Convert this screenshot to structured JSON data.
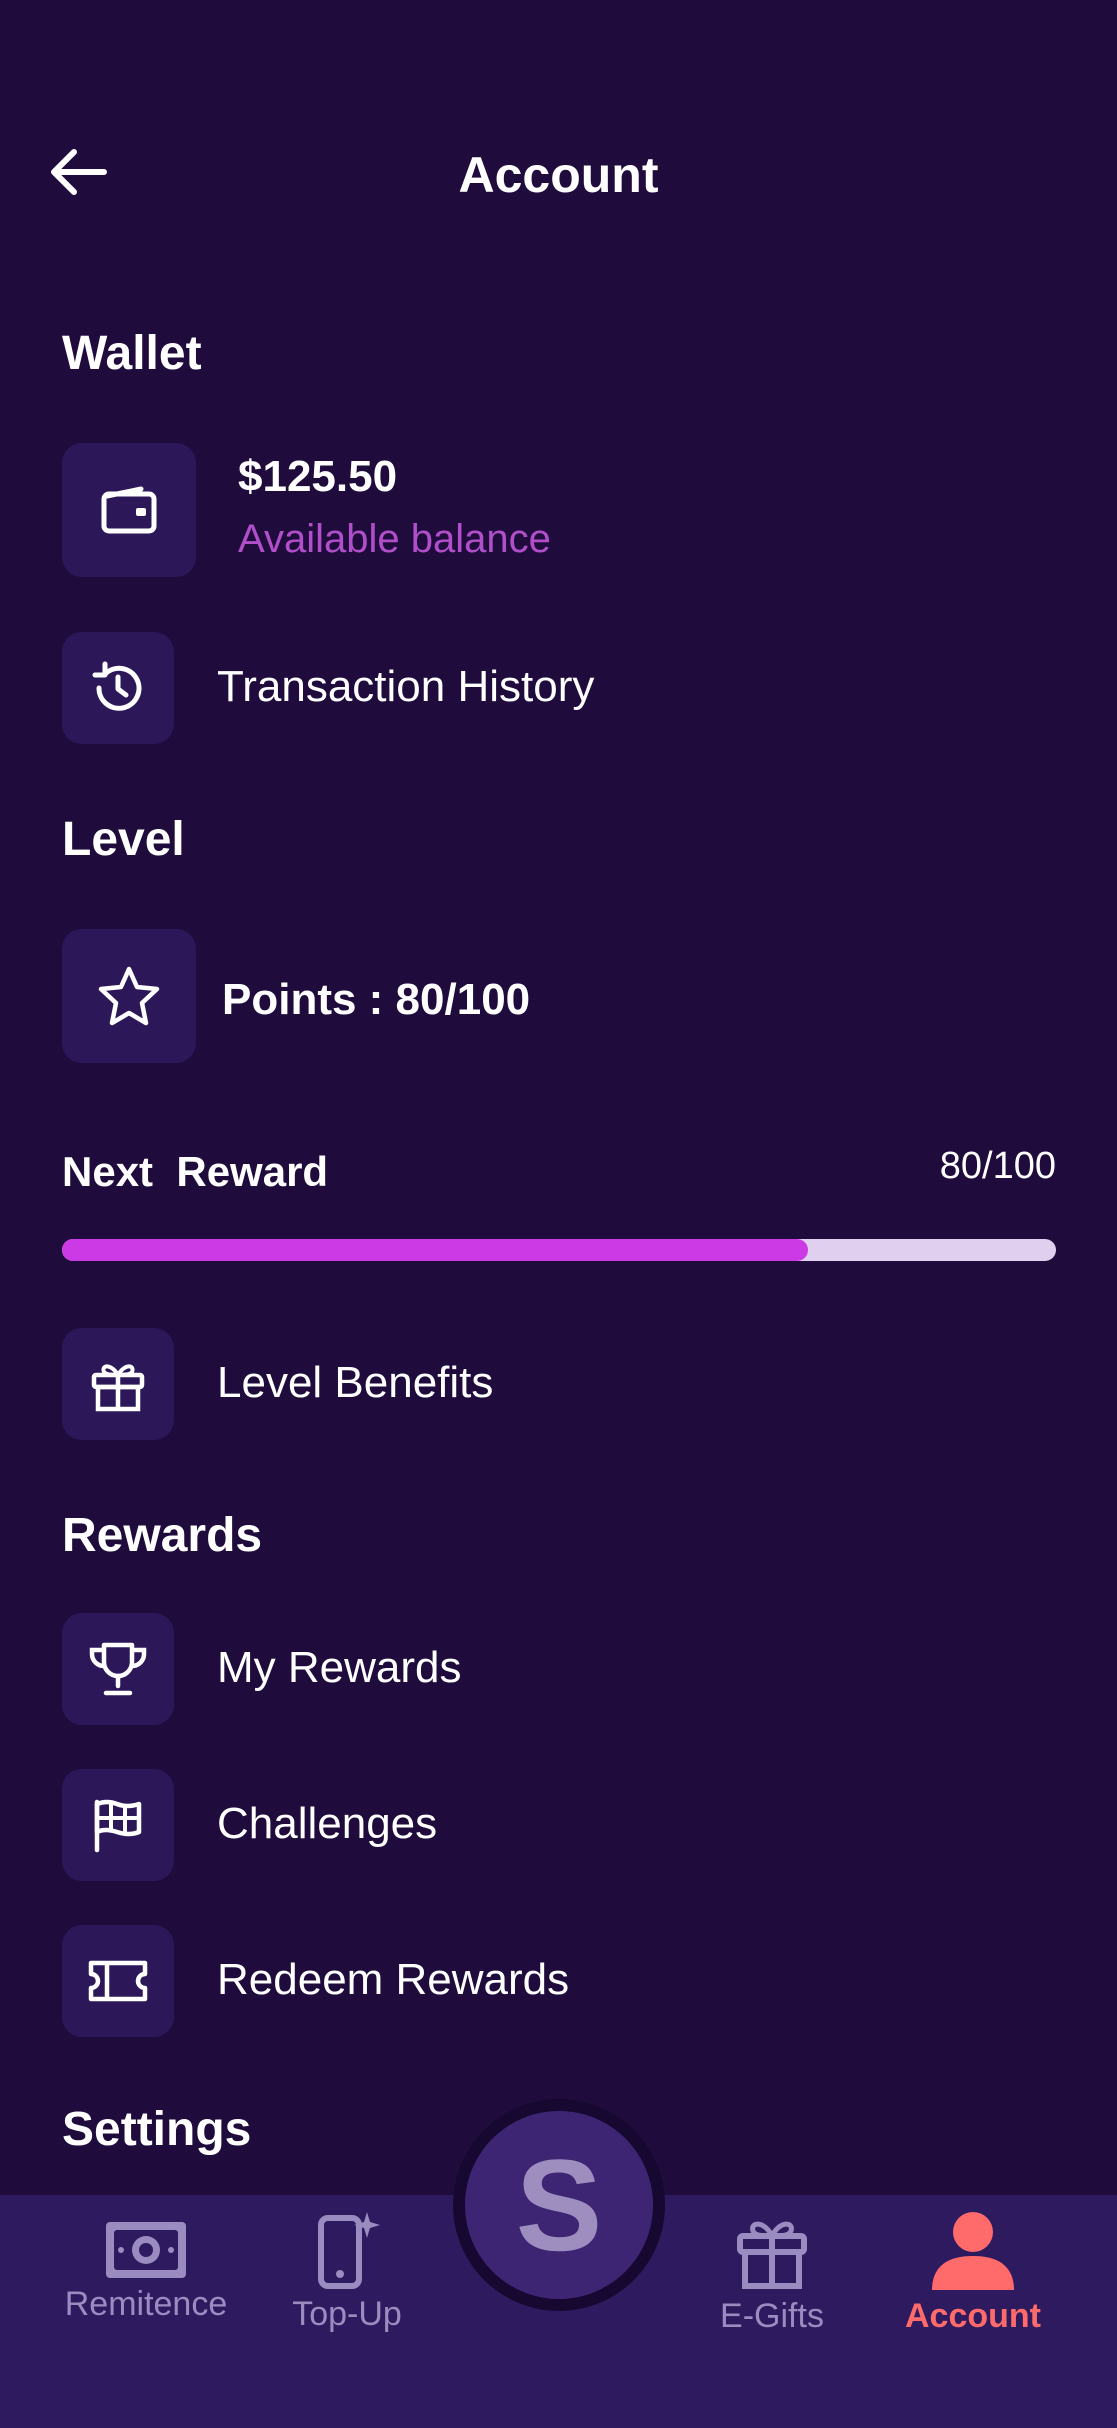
{
  "header": {
    "title": "Account",
    "back_icon": "arrow-left-icon"
  },
  "wallet": {
    "section_title": "Wallet",
    "balance": "$125.50",
    "balance_caption": "Available balance",
    "transaction_history_label": "Transaction History"
  },
  "level": {
    "section_title": "Level",
    "points_label": "Points : 80/100",
    "next_reward_label": "Next  Reward",
    "next_reward_value": "80/100",
    "progress_fraction": 0.75,
    "level_benefits_label": "Level Benefits"
  },
  "rewards": {
    "section_title": "Rewards",
    "items": [
      {
        "label": "My Rewards",
        "icon": "trophy-icon"
      },
      {
        "label": "Challenges",
        "icon": "flag-map-icon"
      },
      {
        "label": "Redeem Rewards",
        "icon": "ticket-icon"
      }
    ]
  },
  "settings": {
    "section_title": "Settings"
  },
  "bottom_nav": {
    "items": [
      {
        "label": "Remitence",
        "icon": "cash-icon",
        "active": false
      },
      {
        "label": "Top-Up",
        "icon": "phone-sparkle-icon",
        "active": false
      },
      {
        "label": "E-Gifts",
        "icon": "gift-icon",
        "active": false
      },
      {
        "label": "Account",
        "icon": "person-icon",
        "active": true
      }
    ],
    "center_button_letter": "S"
  },
  "colors": {
    "background": "#1f0c3d",
    "tile": "#2c1858",
    "accent_purple": "#cc3ae6",
    "caption_purple": "#b04fc9",
    "active_nav": "#ff6b6b",
    "inactive_nav": "#9a8cc0"
  }
}
